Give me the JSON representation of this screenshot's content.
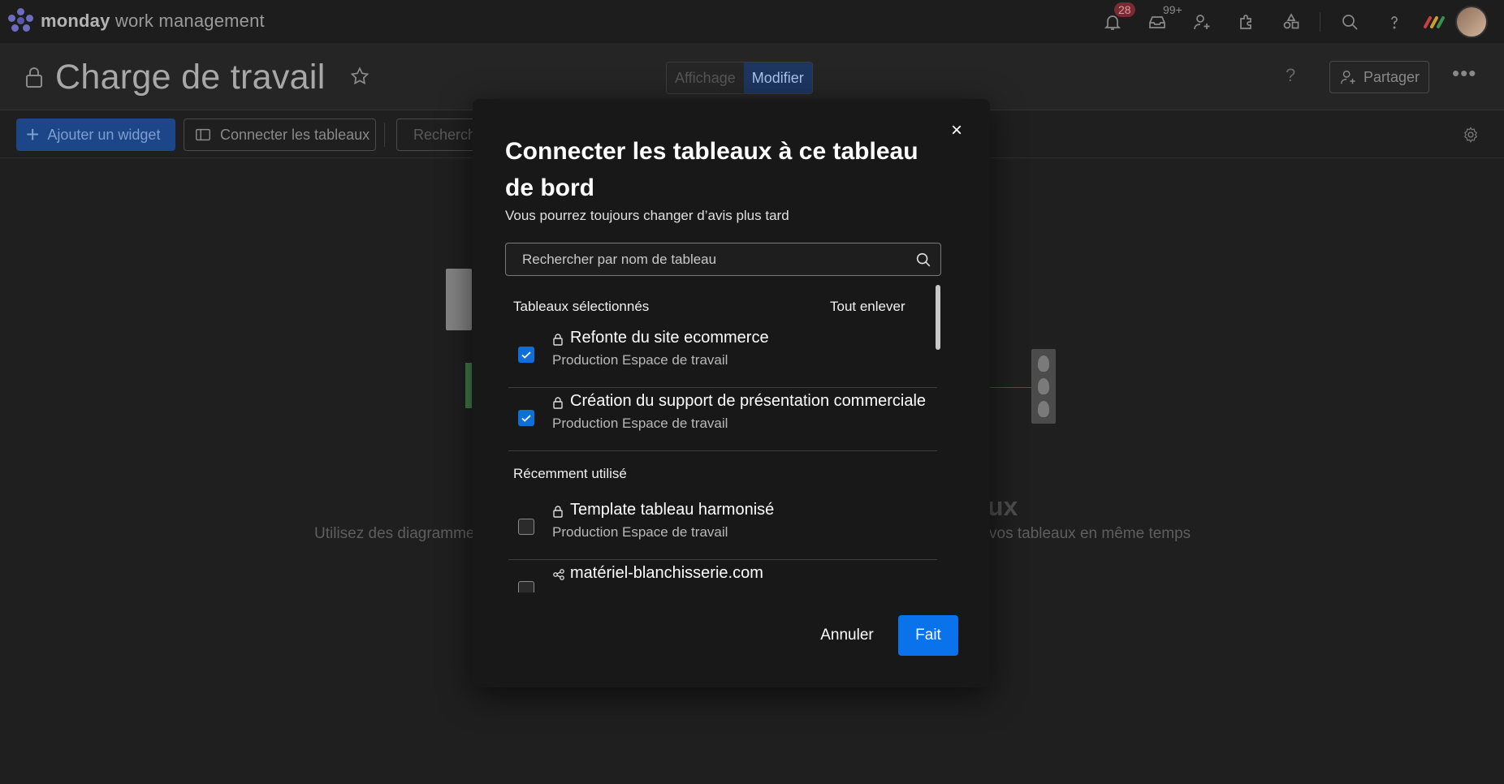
{
  "app": {
    "brand_bold": "monday",
    "brand_rest": " work management",
    "notifications_badge": "28",
    "inbox_badge": "99+"
  },
  "header": {
    "title": "Charge de travail",
    "view_label": "Affichage",
    "edit_label": "Modifier",
    "help": "?",
    "share_label": "Partager",
    "more": "•••"
  },
  "toolbar": {
    "add_widget_label": "Ajouter un widget",
    "connect_boards_label": "Connecter les tableaux",
    "search_placeholder": "Recherch"
  },
  "background": {
    "title_fragment": "ux",
    "desc_left": "Utilisez des diagramme",
    "desc_right": "vos tableaux en même temps"
  },
  "modal": {
    "title": "Connecter les tableaux à ce tableau de bord",
    "subtitle": "Vous pourrez toujours changer d’avis plus tard",
    "search_placeholder": "Rechercher par nom de tableau",
    "selected_header": "Tableaux sélectionnés",
    "clear_all": "Tout enlever",
    "recent_header": "Récemment utilisé",
    "selected_items": [
      {
        "name": "Refonte du site ecommerce",
        "workspace": "Production Espace de travail",
        "checked": true,
        "icon": "lock-icon"
      },
      {
        "name": "Création du support de présentation commerciale",
        "workspace": "Production Espace de travail",
        "checked": true,
        "icon": "lock-icon"
      }
    ],
    "recent_items": [
      {
        "name": "Template tableau harmonisé",
        "workspace": "Production Espace de travail",
        "checked": false,
        "icon": "lock-icon"
      },
      {
        "name": "matériel-blanchisserie.com",
        "workspace": "",
        "checked": false,
        "icon": "share-icon"
      }
    ],
    "close": "×",
    "cancel_label": "Annuler",
    "done_label": "Fait"
  },
  "colors": {
    "primary": "#0a73eb",
    "background": "#1f1f1f",
    "modal_bg": "#181818"
  }
}
